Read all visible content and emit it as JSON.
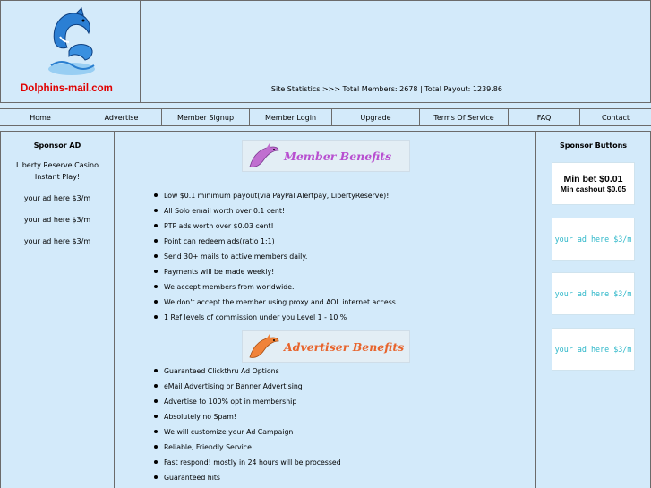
{
  "header": {
    "brand": "Dolphins-mail.com",
    "stats": "Site Statistics >>> Total Members: 2678 | Total Payout: 1239.86"
  },
  "nav": {
    "items": [
      {
        "label": "Home"
      },
      {
        "label": "Advertise"
      },
      {
        "label": "Member Signup"
      },
      {
        "label": "Member Login"
      },
      {
        "label": "Upgrade"
      },
      {
        "label": "Terms Of Service"
      },
      {
        "label": "FAQ"
      },
      {
        "label": "Contact"
      }
    ]
  },
  "left": {
    "title": "Sponsor AD",
    "casino": "Liberty Reserve Casino Instant Play!",
    "ads": [
      "your ad here $3/m",
      "your ad here $3/m",
      "your ad here $3/m"
    ]
  },
  "member": {
    "title": "Member Benefits",
    "items": [
      "Low $0.1 minimum payout(via PayPal,Alertpay, LibertyReserve)!",
      "All Solo email worth over 0.1 cent!",
      "PTP ads worth over $0.03 cent!",
      "Point can redeem ads(ratio 1:1)",
      "Send 30+ mails to active members daily.",
      "Payments will be made weekly!",
      "We accept members from worldwide.",
      "We don't accept the member using proxy and AOL internet access",
      "1 Ref levels of commission under you Level 1 - 10 %"
    ]
  },
  "advertiser": {
    "title": "Advertiser Benefits",
    "items": [
      "Guaranteed Clickthru Ad Options",
      "eMail Advertising or Banner Advertising",
      "Advertise to 100% opt in membership",
      "Absolutely no Spam!",
      "We will customize your Ad Campaign",
      "Reliable, Friendly Service",
      "Fast respond! mostly in 24 hours will be processed",
      "Guaranteed hits"
    ]
  },
  "right": {
    "title": "Sponsor Buttons",
    "minbet_line1": "Min bet $0.01",
    "minbet_line2": "Min cashout $0.05",
    "ads": [
      "your ad here $3/m",
      "your ad here $3/m",
      "your ad here $3/m"
    ]
  }
}
